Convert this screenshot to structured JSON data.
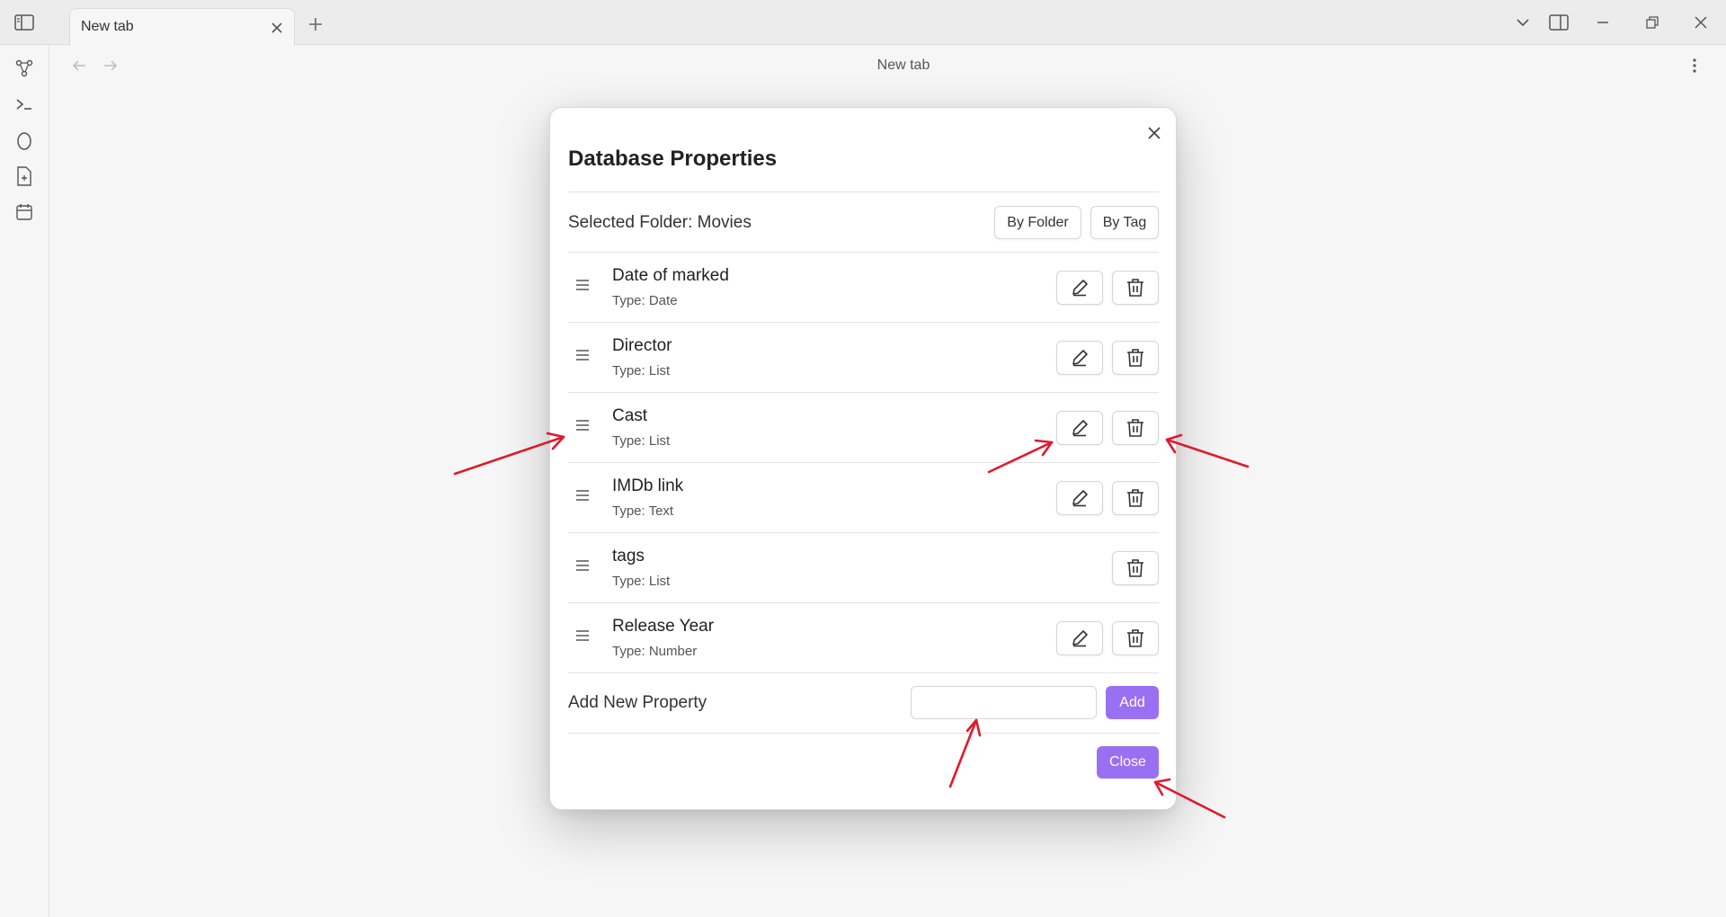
{
  "window": {
    "tab_title": "New tab",
    "icons": {
      "sidebar_toggle": "sidebar-toggle-icon",
      "tab_close": "close-icon",
      "new_tab": "plus-icon",
      "tab_list": "chevron-down-icon",
      "right_sidebar": "right-sidebar-icon",
      "minimize": "minimize-icon",
      "maximize": "restore-icon",
      "close": "close-icon"
    }
  },
  "ribbon": {
    "items": [
      "graph-icon",
      "terminal-icon",
      "canvas-icon",
      "new-note-icon",
      "calendar-icon"
    ]
  },
  "view": {
    "title": "New tab",
    "back_icon": "arrow-left-icon",
    "forward_icon": "arrow-right-icon",
    "more_icon": "more-vertical-icon"
  },
  "modal": {
    "title": "Database Properties",
    "selected_folder": "Selected Folder: Movies",
    "by_folder_label": "By Folder",
    "by_tag_label": "By Tag",
    "properties": [
      {
        "name": "Date of marked",
        "type": "Type: Date",
        "editable": true
      },
      {
        "name": "Director",
        "type": "Type: List",
        "editable": true
      },
      {
        "name": "Cast",
        "type": "Type: List",
        "editable": true
      },
      {
        "name": "IMDb link",
        "type": "Type: Text",
        "editable": true
      },
      {
        "name": "tags",
        "type": "Type: List",
        "editable": false
      },
      {
        "name": "Release Year",
        "type": "Type: Number",
        "editable": true
      }
    ],
    "add_new_label": "Add New Property",
    "add_input_value": "",
    "add_button_label": "Add",
    "close_button_label": "Close"
  },
  "colors": {
    "accent": "#9a70f2",
    "annotation_arrow": "#e0192e",
    "background": "#f6f6f6"
  }
}
